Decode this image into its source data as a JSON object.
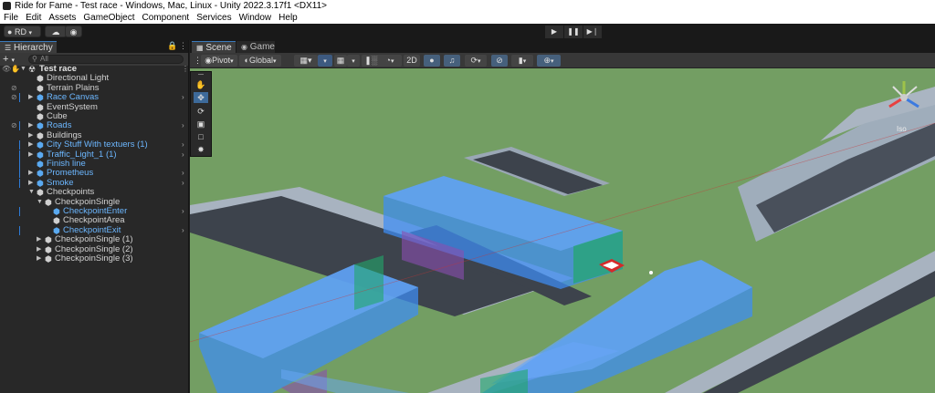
{
  "window": {
    "title": "Ride for Fame - Test race - Windows, Mac, Linux - Unity 2022.3.17f1 <DX11>"
  },
  "menu": [
    "File",
    "Edit",
    "Assets",
    "GameObject",
    "Component",
    "Services",
    "Window",
    "Help"
  ],
  "toolbar": {
    "account_label": "RD",
    "account_icon": "account-icon",
    "cloud_icon": "cloud-icon",
    "collab_icon": "collab-icon",
    "play_icon": "play-icon",
    "pause_icon": "pause-icon",
    "step_icon": "step-icon"
  },
  "hierarchy": {
    "tab_label": "Hierarchy",
    "search_placeholder": "All",
    "scene_name": "Test race",
    "items": [
      {
        "label": "Directional Light",
        "depth": 1,
        "expandable": false,
        "prefab": false,
        "hidden": false,
        "child_arrow": false,
        "marker": false
      },
      {
        "label": "Terrain Plains",
        "depth": 1,
        "expandable": false,
        "prefab": false,
        "hidden": true,
        "child_arrow": false,
        "marker": false
      },
      {
        "label": "Race Canvas",
        "depth": 1,
        "expandable": true,
        "prefab": true,
        "hidden": true,
        "child_arrow": true,
        "marker": true
      },
      {
        "label": "EventSystem",
        "depth": 1,
        "expandable": false,
        "prefab": false,
        "hidden": false,
        "child_arrow": false,
        "marker": false
      },
      {
        "label": "Cube",
        "depth": 1,
        "expandable": false,
        "prefab": false,
        "hidden": false,
        "child_arrow": false,
        "marker": false
      },
      {
        "label": "Roads",
        "depth": 1,
        "expandable": true,
        "prefab": true,
        "hidden": true,
        "child_arrow": true,
        "marker": true
      },
      {
        "label": "Buildings",
        "depth": 1,
        "expandable": true,
        "prefab": false,
        "hidden": false,
        "child_arrow": false,
        "marker": false
      },
      {
        "label": "City Stuff With textuers (1)",
        "depth": 1,
        "expandable": true,
        "prefab": true,
        "hidden": false,
        "child_arrow": true,
        "marker": true
      },
      {
        "label": "Traffic_Light_1 (1)",
        "depth": 1,
        "expandable": true,
        "prefab": true,
        "hidden": false,
        "child_arrow": true,
        "marker": true
      },
      {
        "label": "Finish line",
        "depth": 1,
        "expandable": false,
        "prefab": true,
        "hidden": false,
        "child_arrow": false,
        "marker": true
      },
      {
        "label": "Prometheus",
        "depth": 1,
        "expandable": true,
        "prefab": true,
        "hidden": false,
        "child_arrow": true,
        "marker": true
      },
      {
        "label": "Smoke",
        "depth": 1,
        "expandable": true,
        "prefab": true,
        "hidden": false,
        "child_arrow": true,
        "marker": true
      },
      {
        "label": "Checkpoints",
        "depth": 1,
        "expandable": true,
        "expanded": true,
        "prefab": false,
        "hidden": false,
        "child_arrow": false,
        "marker": false
      },
      {
        "label": "CheckpoinSingle",
        "depth": 2,
        "expandable": true,
        "expanded": true,
        "prefab": false,
        "hidden": false,
        "child_arrow": false,
        "marker": false
      },
      {
        "label": "CheckpointEnter",
        "depth": 3,
        "expandable": false,
        "prefab": true,
        "hidden": false,
        "child_arrow": true,
        "marker": true
      },
      {
        "label": "CheckpointArea",
        "depth": 3,
        "expandable": false,
        "prefab": false,
        "hidden": false,
        "child_arrow": false,
        "marker": false
      },
      {
        "label": "CheckpointExit",
        "depth": 3,
        "expandable": false,
        "prefab": true,
        "hidden": false,
        "child_arrow": true,
        "marker": true
      },
      {
        "label": "CheckpoinSingle (1)",
        "depth": 2,
        "expandable": true,
        "prefab": false,
        "hidden": false,
        "child_arrow": false,
        "marker": false
      },
      {
        "label": "CheckpoinSingle (2)",
        "depth": 2,
        "expandable": true,
        "prefab": false,
        "hidden": false,
        "child_arrow": false,
        "marker": false
      },
      {
        "label": "CheckpoinSingle (3)",
        "depth": 2,
        "expandable": true,
        "prefab": false,
        "hidden": false,
        "child_arrow": false,
        "marker": false
      }
    ]
  },
  "scene": {
    "tabs": [
      {
        "label": "Scene",
        "active": true
      },
      {
        "label": "Game",
        "active": false
      }
    ],
    "toolbar": {
      "pivot_label": "Pivot",
      "global_label": "Global",
      "mode_2d_label": "2D",
      "lighting_icon": "light-bulb-icon",
      "audio_icon": "audio-icon",
      "effects_icon": "effects-icon",
      "hidden_icon": "visibility-icon",
      "camera_icon": "camera-icon",
      "gizmos_icon": "gizmos-icon"
    },
    "gizmo_label": "Iso",
    "tools": [
      "hand-tool-icon",
      "move-tool-icon",
      "rotate-tool-icon",
      "scale-tool-icon",
      "rect-tool-icon",
      "transform-tool-icon"
    ],
    "colors": {
      "grass": "#739e63",
      "road": "#3d434c",
      "sidewalk": "#aab5c2",
      "checkpoint_volume": "#3d8ef5",
      "selection": "#2e7bd6"
    }
  }
}
